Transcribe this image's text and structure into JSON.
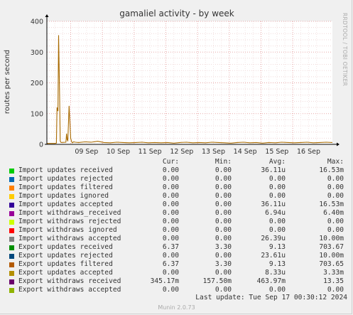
{
  "chart_data": {
    "type": "line",
    "title": "gamaliel activity - by week",
    "ylabel": "routes per second",
    "side_label": "RRDTOOL / TOBI OETIKER",
    "ylim": [
      0,
      400
    ],
    "yticks": [
      0,
      100,
      200,
      300,
      400
    ],
    "x_range": [
      "2024-09-08 06:00",
      "2024-09-17 06:00"
    ],
    "xticks": [
      "09 Sep",
      "10 Sep",
      "11 Sep",
      "12 Sep",
      "13 Sep",
      "14 Sep",
      "15 Sep",
      "16 Sep"
    ],
    "grid": true,
    "series": [
      {
        "name": "Export updates filtered",
        "color": "#a86a00",
        "x": [
          0,
          0.1,
          0.2,
          0.25,
          0.3,
          0.32,
          0.35,
          0.37,
          0.4,
          0.42,
          0.45,
          0.6,
          0.62,
          0.64,
          0.66,
          0.7,
          0.75,
          0.78,
          0.8,
          0.82,
          0.84,
          0.9,
          1.0,
          1.2,
          1.4,
          1.6,
          1.8,
          2.0,
          2.2,
          2.4,
          2.6,
          2.8,
          3.0,
          3.2,
          3.4,
          3.6,
          3.8,
          4.0,
          4.2,
          4.4,
          4.6,
          4.8,
          5.0,
          5.2,
          5.4,
          5.6,
          5.8,
          6.0,
          6.2,
          6.4,
          6.6,
          6.8,
          7.0,
          7.2,
          7.4,
          7.6,
          7.8,
          8.0,
          8.2,
          8.4,
          8.6,
          8.8,
          9.0
        ],
        "y": [
          3,
          3,
          3,
          3,
          4,
          120,
          108,
          355,
          160,
          10,
          6,
          7,
          35,
          15,
          12,
          125,
          20,
          9,
          5,
          6,
          8,
          7,
          6,
          8,
          7,
          10,
          6,
          5,
          7,
          6,
          5,
          6,
          7,
          5,
          6,
          5,
          6,
          4,
          6,
          7,
          5,
          6,
          5,
          7,
          6,
          5,
          4,
          6,
          7,
          5,
          6,
          4,
          6,
          5,
          7,
          6,
          5,
          6,
          7,
          5,
          6,
          7,
          6
        ]
      }
    ]
  },
  "legend": {
    "headers": [
      "Cur:",
      "Min:",
      "Avg:",
      "Max:"
    ],
    "rows": [
      {
        "name": "Import updates received",
        "color": "#00cc00",
        "cur": "0.00",
        "min": "0.00",
        "avg": "36.11u",
        "max": "16.53m"
      },
      {
        "name": "Import updates rejected",
        "color": "#0066b3",
        "cur": "0.00",
        "min": "0.00",
        "avg": "0.00",
        "max": "0.00"
      },
      {
        "name": "Import updates filtered",
        "color": "#ff8000",
        "cur": "0.00",
        "min": "0.00",
        "avg": "0.00",
        "max": "0.00"
      },
      {
        "name": "Import updates ignored",
        "color": "#ffcc00",
        "cur": "0.00",
        "min": "0.00",
        "avg": "0.00",
        "max": "0.00"
      },
      {
        "name": "Import updates accepted",
        "color": "#330099",
        "cur": "0.00",
        "min": "0.00",
        "avg": "36.11u",
        "max": "16.53m"
      },
      {
        "name": "Import withdraws_received",
        "color": "#990099",
        "cur": "0.00",
        "min": "0.00",
        "avg": "6.94u",
        "max": "6.40m"
      },
      {
        "name": "Import withdraws rejected",
        "color": "#ccff00",
        "cur": "0.00",
        "min": "0.00",
        "avg": "0.00",
        "max": "0.00"
      },
      {
        "name": "Import withdraws ignored",
        "color": "#ff0000",
        "cur": "0.00",
        "min": "0.00",
        "avg": "0.00",
        "max": "0.00"
      },
      {
        "name": "Import withdraws accepted",
        "color": "#808080",
        "cur": "0.00",
        "min": "0.00",
        "avg": "26.39u",
        "max": "10.00m"
      },
      {
        "name": "Export updates received",
        "color": "#008f00",
        "cur": "6.37",
        "min": "3.30",
        "avg": "9.13",
        "max": "703.67"
      },
      {
        "name": "Export updates rejected",
        "color": "#00487d",
        "cur": "0.00",
        "min": "0.00",
        "avg": "23.61u",
        "max": "10.00m"
      },
      {
        "name": "Export updates filtered",
        "color": "#b35a00",
        "cur": "6.37",
        "min": "3.30",
        "avg": "9.13",
        "max": "703.65"
      },
      {
        "name": "Export updates accepted",
        "color": "#b38f00",
        "cur": "0.00",
        "min": "0.00",
        "avg": "8.33u",
        "max": "3.33m"
      },
      {
        "name": "Export withdraws received",
        "color": "#6b006b",
        "cur": "345.17m",
        "min": "157.50m",
        "avg": "463.97m",
        "max": "13.35"
      },
      {
        "name": "Export withdraws accepted",
        "color": "#8fb300",
        "cur": "0.00",
        "min": "0.00",
        "avg": "0.00",
        "max": "0.00"
      }
    ]
  },
  "last_update": "Last update: Tue Sep 17 00:30:12 2024",
  "footer": "Munin 2.0.73"
}
